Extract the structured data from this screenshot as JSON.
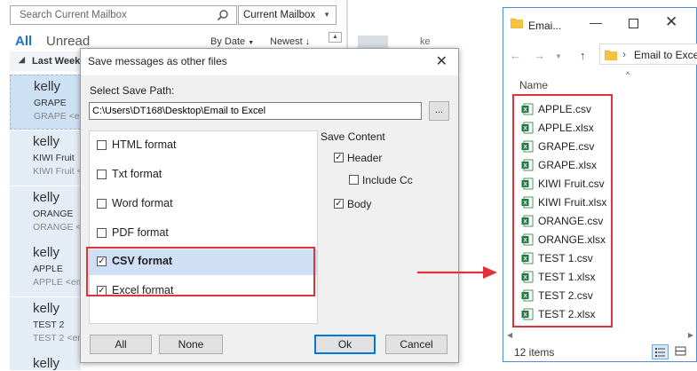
{
  "outlook": {
    "search_placeholder": "Search Current Mailbox",
    "scope": "Current Mailbox",
    "tab_all": "All",
    "tab_unread": "Unread",
    "sort_by": "By Date",
    "order": "Newest",
    "order_arrow": "↓",
    "group_header": "Last Week",
    "reading_name_fragment": "ke",
    "mails": [
      {
        "from": "kelly",
        "subject": "GRAPE",
        "preview": "GRAPE <em"
      },
      {
        "from": "kelly",
        "subject": "KIWI Fruit",
        "preview": "KIWI Fruit <"
      },
      {
        "from": "kelly",
        "subject": "ORANGE",
        "preview": "ORANGE <e"
      },
      {
        "from": "kelly",
        "subject": "APPLE",
        "preview": "APPLE <em"
      },
      {
        "from": "kelly",
        "subject": "TEST 2",
        "preview": "TEST 2 <em"
      },
      {
        "from": "kelly",
        "subject": "",
        "preview": ""
      }
    ]
  },
  "dialog": {
    "title": "Save messages as other files",
    "close": "✕",
    "path_label": "Select Save Path:",
    "path_value": "C:\\Users\\DT168\\Desktop\\Email to Excel",
    "browse_label": "...",
    "formats": [
      {
        "label": "HTML format",
        "checked": false
      },
      {
        "label": "Txt format",
        "checked": false
      },
      {
        "label": "Word format",
        "checked": false
      },
      {
        "label": "PDF format",
        "checked": false
      },
      {
        "label": "CSV format",
        "checked": true
      },
      {
        "label": "Excel format",
        "checked": true
      }
    ],
    "save_content_label": "Save Content",
    "save_content": {
      "header": {
        "label": "Header",
        "checked": true
      },
      "include_cc": {
        "label": "Include Cc",
        "checked": false
      },
      "body": {
        "label": "Body",
        "checked": true
      }
    },
    "buttons": {
      "all": "All",
      "none": "None",
      "ok": "Ok",
      "cancel": "Cancel"
    }
  },
  "explorer": {
    "title": "Emai...",
    "address": "Email to Exce",
    "column_name": "Name",
    "files": [
      {
        "name": "APPLE.csv",
        "type": "csv"
      },
      {
        "name": "APPLE.xlsx",
        "type": "xlsx"
      },
      {
        "name": "GRAPE.csv",
        "type": "csv"
      },
      {
        "name": "GRAPE.xlsx",
        "type": "xlsx"
      },
      {
        "name": "KIWI Fruit.csv",
        "type": "csv"
      },
      {
        "name": "KIWI Fruit.xlsx",
        "type": "xlsx"
      },
      {
        "name": "ORANGE.csv",
        "type": "csv"
      },
      {
        "name": "ORANGE.xlsx",
        "type": "xlsx"
      },
      {
        "name": "TEST 1.csv",
        "type": "csv"
      },
      {
        "name": "TEST 1.xlsx",
        "type": "xlsx"
      },
      {
        "name": "TEST 2.csv",
        "type": "csv"
      },
      {
        "name": "TEST 2.xlsx",
        "type": "xlsx"
      }
    ],
    "status": "12 items"
  },
  "colors": {
    "accent": "#1a73c7",
    "highlight_red": "#e0323a",
    "selection": "#cfe0f6",
    "excel_green": "#1d7a3e"
  }
}
